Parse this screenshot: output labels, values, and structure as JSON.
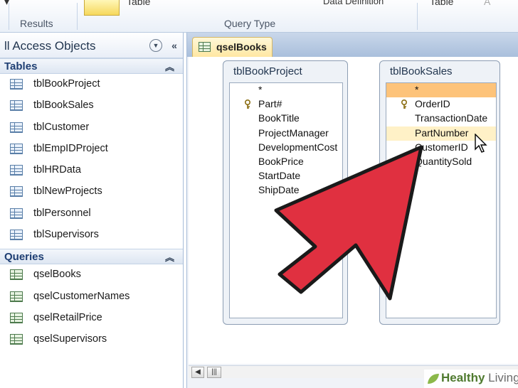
{
  "ribbon": {
    "results_label": "Results",
    "query_type_label": "Query Type",
    "table_label": "Table",
    "data_definition_label": "Data Definition",
    "table2_label": "Table"
  },
  "nav": {
    "title": "ll Access Objects",
    "sections": {
      "tables": {
        "label": "Tables",
        "items": [
          "tblBookProject",
          "tblBookSales",
          "tblCustomer",
          "tblEmpIDProject",
          "tblHRData",
          "tblNewProjects",
          "tblPersonnel",
          "tblSupervisors"
        ]
      },
      "queries": {
        "label": "Queries",
        "items": [
          "qselBooks",
          "qselCustomerNames",
          "qselRetailPrice",
          "qselSupervisors"
        ]
      }
    }
  },
  "tabs": [
    {
      "label": "qselBooks"
    }
  ],
  "design": {
    "table1": {
      "title": "tblBookProject",
      "fields": [
        "*",
        "Part#",
        "BookTitle",
        "ProjectManager",
        "DevelopmentCost",
        "BookPrice",
        "StartDate",
        "ShipDate"
      ]
    },
    "table2": {
      "title": "tblBookSales",
      "fields": [
        "*",
        "OrderID",
        "TransactionDate",
        "PartNumber",
        "CustomerID",
        "QuantitySold"
      ]
    }
  },
  "watermark": {
    "brand": "Healthy",
    "rest": " Living"
  },
  "colors": {
    "arrow": "#e03040",
    "arrow_outline": "#1a1a1a",
    "tab": "#ffe7a2",
    "highlight": "#fdc37a"
  }
}
